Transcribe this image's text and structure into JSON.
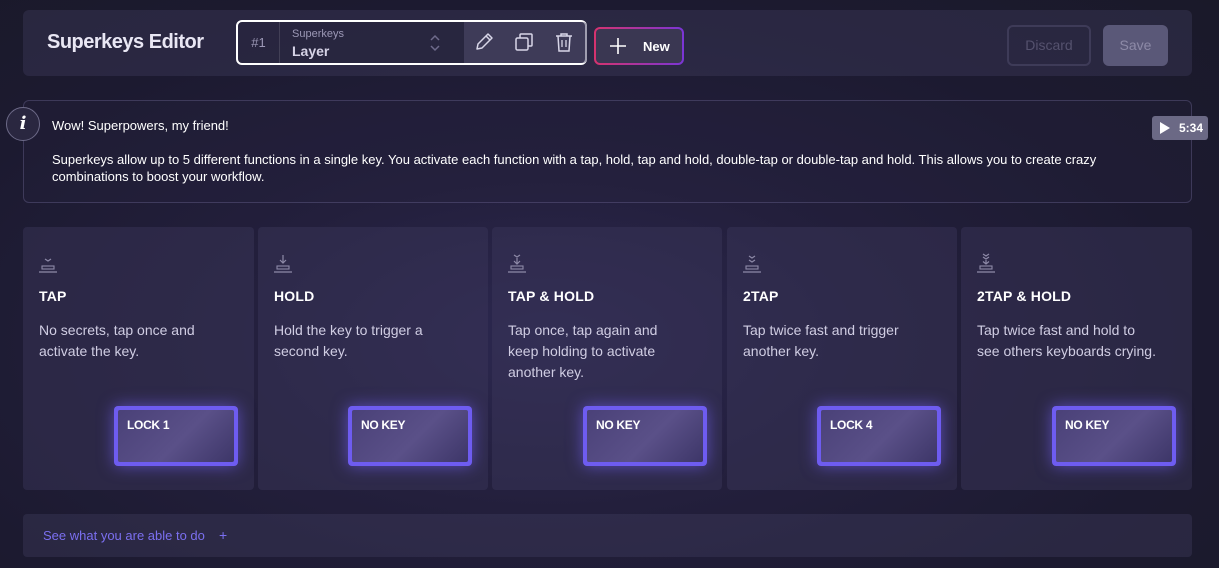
{
  "header": {
    "title": "Superkeys Editor",
    "layer": {
      "number": "#1",
      "caption": "Superkeys",
      "name": "Layer"
    },
    "actions": {
      "new_label": "New",
      "discard_label": "Discard",
      "save_label": "Save"
    }
  },
  "info": {
    "title": "Wow! Superpowers, my friend!",
    "text": "Superkeys allow up to 5 different functions in a single key. You activate each function with a tap, hold, tap and hold, double-tap or double-tap and hold. This allows you to create crazy combinations to boost your workflow.",
    "video_time": "5:34"
  },
  "cards": [
    {
      "title": "TAP",
      "desc": "No secrets, tap once and activate the key.",
      "key": "LOCK 1",
      "icon": "tap-icon"
    },
    {
      "title": "HOLD",
      "desc": "Hold the key to trigger a second key.",
      "key": "NO KEY",
      "icon": "hold-icon"
    },
    {
      "title": "TAP & HOLD",
      "desc": "Tap once, tap again and keep holding to activate another key.",
      "key": "NO KEY",
      "icon": "tap-and-hold-icon"
    },
    {
      "title": "2TAP",
      "desc": "Tap twice fast and trigger another key.",
      "key": "LOCK 4",
      "icon": "double-tap-icon"
    },
    {
      "title": "2TAP & HOLD",
      "desc": "Tap twice fast and hold to see others keyboards crying.",
      "key": "NO KEY",
      "icon": "double-tap-and-hold-icon"
    }
  ],
  "footer": {
    "link_label": "See what you are able to do",
    "plus": "+"
  },
  "colors": {
    "accent": "#6e5cf0",
    "link": "#7b6ff0",
    "new_gradient_start": "#d6336e",
    "new_gradient_end": "#7a35d6"
  }
}
